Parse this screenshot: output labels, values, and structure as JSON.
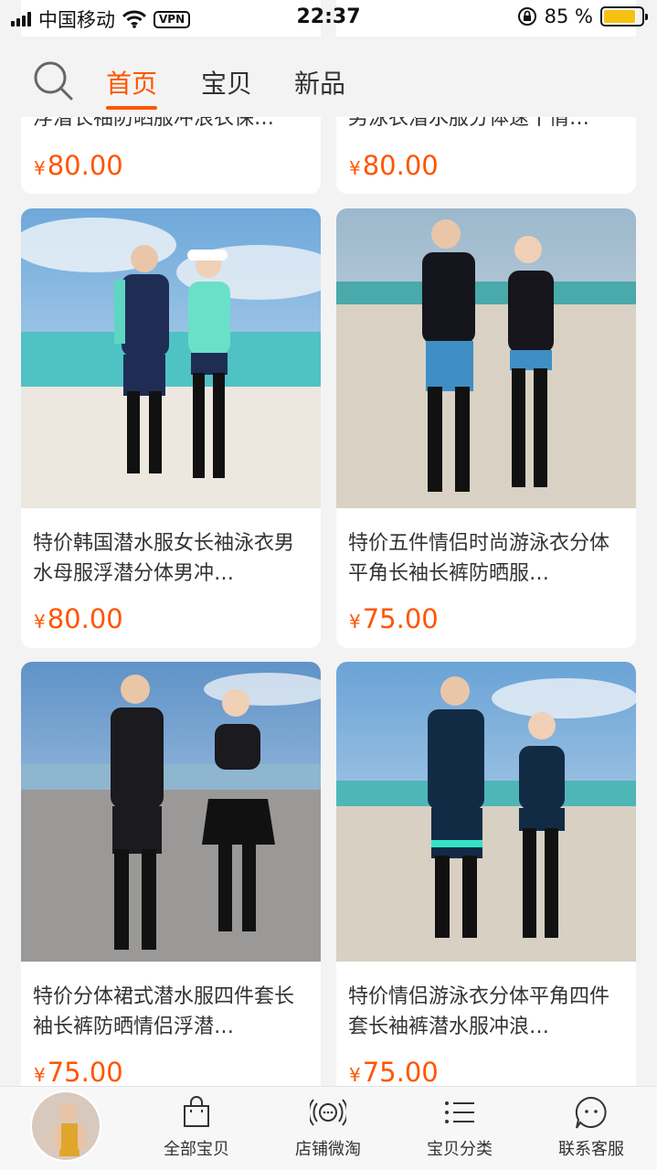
{
  "status_bar": {
    "carrier": "中国移动",
    "vpn": "VPN",
    "time": "22:37",
    "battery_percent": "85 %",
    "battery_level": 0.85
  },
  "nav": {
    "tabs": [
      {
        "label": "首页",
        "active": true
      },
      {
        "label": "宝贝",
        "active": false
      },
      {
        "label": "新品",
        "active": false
      }
    ]
  },
  "products": [
    {
      "title": "浮潜长袖防晒服冲浪衣保…",
      "price": "80.00"
    },
    {
      "title": "男泳衣潜水服分体速干情…",
      "price": "80.00"
    },
    {
      "title": "特价韩国潜水服女长袖泳衣男水母服浮潜分体男冲…",
      "price": "80.00"
    },
    {
      "title": "特价五件情侣时尚游泳衣分体平角长袖长裤防晒服…",
      "price": "75.00"
    },
    {
      "title": "特价分体裙式潜水服四件套长袖长裤防晒情侣浮潜…",
      "price": "75.00"
    },
    {
      "title": "特价情侣游泳衣分体平角四件套长袖裤潜水服冲浪…",
      "price": "75.00"
    }
  ],
  "currency": "¥",
  "bottom_bar": {
    "items": [
      {
        "label": "全部宝贝",
        "icon": "shopping-bag-icon"
      },
      {
        "label": "店铺微淘",
        "icon": "broadcast-icon"
      },
      {
        "label": "宝贝分类",
        "icon": "list-icon"
      },
      {
        "label": "联系客服",
        "icon": "chat-face-icon"
      }
    ]
  },
  "colors": {
    "accent": "#ff5500",
    "battery": "#f5c211"
  }
}
